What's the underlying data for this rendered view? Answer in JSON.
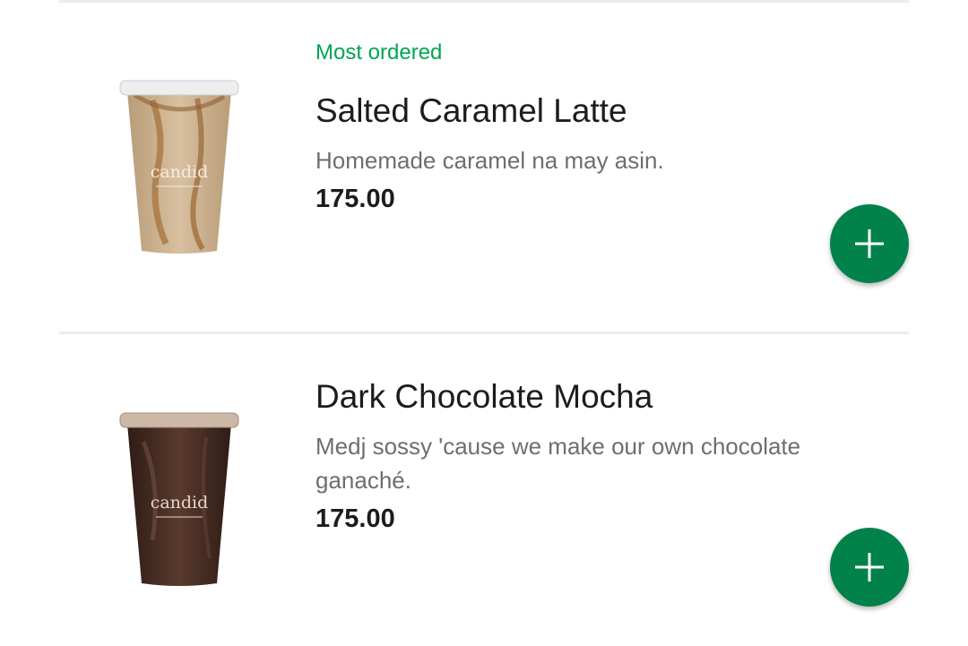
{
  "menu": {
    "items": [
      {
        "badge": "Most ordered",
        "name": "Salted Caramel Latte",
        "description": "Homemade caramel na may asin.",
        "price": "175.00",
        "image_brand": "candid"
      },
      {
        "badge": "",
        "name": "Dark Chocolate Mocha",
        "description": "Medj sossy 'cause we make our own chocolate ganaché.",
        "price": "175.00",
        "image_brand": "candid"
      }
    ],
    "add_icon": "plus-icon"
  },
  "colors": {
    "accent_green": "#00a651",
    "button_green": "#00824a",
    "text_primary": "#1c1c1c",
    "text_secondary": "#6b6f73",
    "divider": "#ececec"
  }
}
